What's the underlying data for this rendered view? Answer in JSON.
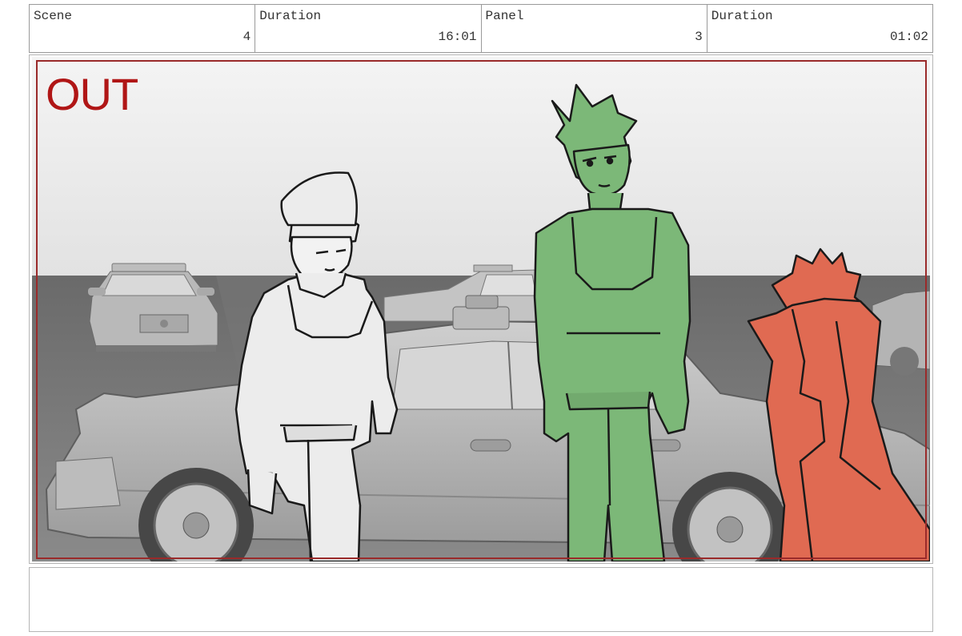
{
  "header": {
    "scene_label": "Scene",
    "scene_value": "4",
    "scene_duration_label": "Duration",
    "scene_duration_value": "16:01",
    "panel_label": "Panel",
    "panel_value": "3",
    "panel_duration_label": "Duration",
    "panel_duration_value": "01:02"
  },
  "panel": {
    "transition_label": "OUT",
    "label_color": "#b01616",
    "frame_color": "#9a2a2a"
  },
  "characters": {
    "left_color": "#ececec",
    "center_color": "#7cb878",
    "right_color": "#e06a52"
  },
  "notes": {
    "text": ""
  }
}
